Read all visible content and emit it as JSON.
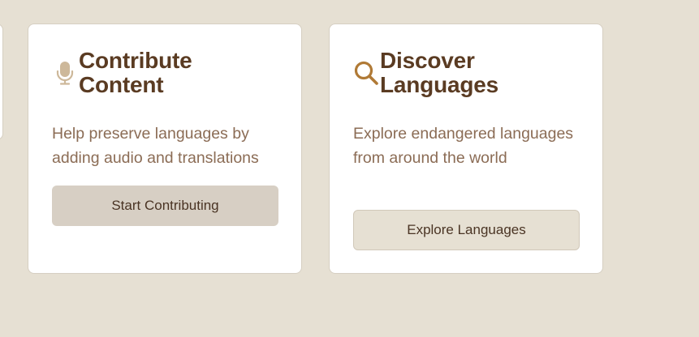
{
  "cards": [
    {
      "icon": "microphone-icon",
      "title_line1": "Contribute",
      "title_line2": "Content",
      "description": "Help preserve languages by adding audio and translations",
      "button_label": "Start Contributing"
    },
    {
      "icon": "search-icon",
      "title_line1": "Discover",
      "title_line2": "Languages",
      "description": "Explore endangered languages from around the world",
      "button_label": "Explore Languages"
    }
  ],
  "colors": {
    "background": "#e6e0d3",
    "title": "#5a3b22",
    "description": "#8b6c55",
    "microphone_icon": "#cdb89a",
    "search_icon": "#b07a36"
  }
}
